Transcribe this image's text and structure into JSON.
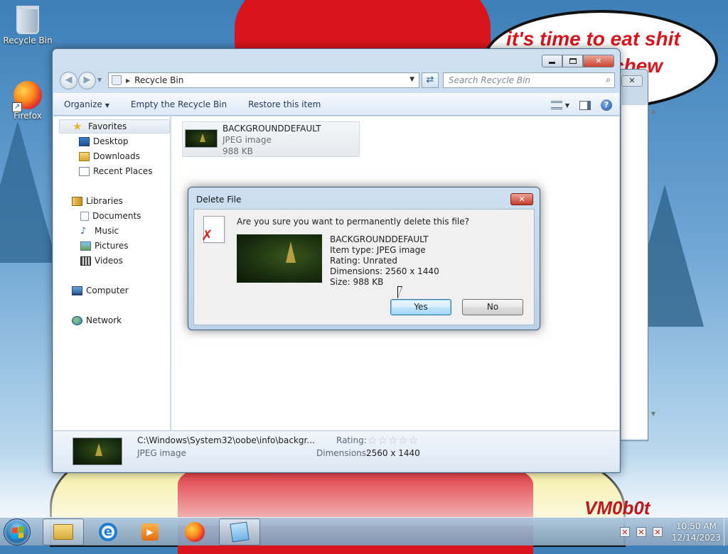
{
  "desktop": {
    "icons": [
      {
        "label": "Recycle Bin",
        "icon": "recycle-bin-icon"
      },
      {
        "label": "Firefox",
        "icon": "firefox-icon"
      }
    ],
    "wallpaper_text": {
      "speech_line1": "it's time to eat shit",
      "speech_line2": "chew",
      "signature": "VM0b0t"
    }
  },
  "explorer": {
    "address": {
      "crumb": "Recycle Bin"
    },
    "search": {
      "placeholder": "Search Recycle Bin"
    },
    "commands": {
      "organize": "Organize",
      "empty": "Empty the Recycle Bin",
      "restore": "Restore this item"
    },
    "nav": {
      "favorites": "Favorites",
      "desktop": "Desktop",
      "downloads": "Downloads",
      "recent_places": "Recent Places",
      "libraries": "Libraries",
      "documents": "Documents",
      "music": "Music",
      "pictures": "Pictures",
      "videos": "Videos",
      "computer": "Computer",
      "network": "Network"
    },
    "file": {
      "name": "BACKGROUNDDEFAULT",
      "type": "JPEG image",
      "size": "988 KB"
    },
    "details": {
      "path": "C:\\Windows\\System32\\oobe\\info\\backgr...",
      "type": "JPEG image",
      "rating_label": "Rating:",
      "rating_stars": "☆☆☆☆☆",
      "dimensions_label": "Dimensions:",
      "dimensions_value": "2560 x 1440"
    }
  },
  "dialog": {
    "title": "Delete File",
    "question": "Are you sure you want to permanently delete this file?",
    "file_name": "BACKGROUNDDEFAULT",
    "item_type": "Item type: JPEG image",
    "rating": "Rating: Unrated",
    "dimensions": "Dimensions: 2560 x 1440",
    "size": "Size: 988 KB",
    "yes_label": "Yes",
    "no_label": "No",
    "close_glyph": "✕"
  },
  "taskbar": {
    "apps": [
      "windows-explorer",
      "internet-explorer",
      "windows-media-player",
      "firefox",
      "notepad"
    ],
    "clock": {
      "time": "10:50 AM",
      "date": "12/14/2023"
    }
  },
  "colors": {
    "dialog_default_button": "#bee6fd",
    "close_button": "#c33b25",
    "window_frame": "#bcd3ea"
  }
}
